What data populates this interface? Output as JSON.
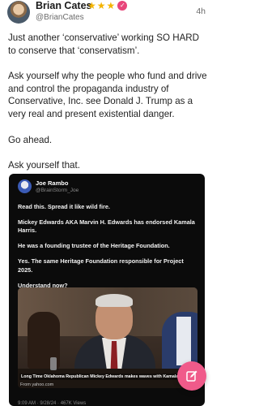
{
  "post": {
    "author": {
      "name": "Brian Cates",
      "handle": "@BrianCates",
      "star_rating": 3,
      "verified_badge": "verified-badge-icon"
    },
    "time": "4h",
    "paragraphs": [
      "Just another ‘conservative’ working SO HARD to conserve that ‘conservatism’.",
      "Ask yourself why the people who fund and drive and control the propaganda industry of Conservative, Inc. see Donald J. Trump as a very real and present existential danger.",
      "Go ahead.",
      "Ask yourself that."
    ]
  },
  "embed": {
    "author_name": "Joe Rambo",
    "author_handle": "@BrainStorm_Joe",
    "paragraphs": [
      "Read this. Spread it like wild fire.",
      "Mickey Edwards AKA Marvin H. Edwards has endorsed Kamala Harris.",
      "He was a founding trustee of the Heritage Foundation.",
      "Yes. The same Heritage Foundation responsible for Project 2025.",
      "Understand now?"
    ],
    "image_caption": "Long Time Oklahoma Republican Mickey Edwards makes waves with Kamala Harris endorsement",
    "image_source": "From yahoo.com",
    "meta_line": "9:09 AM · 9/28/24 · 467K Views"
  },
  "fab": {
    "icon": "compose-icon"
  },
  "colors": {
    "accent": "#f05a8a",
    "star": "#f4b400",
    "embed_bg": "#0b0b0b"
  }
}
